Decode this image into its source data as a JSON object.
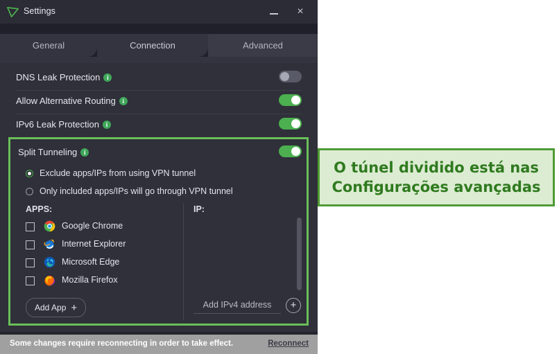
{
  "window": {
    "title": "Settings",
    "logo_icon": "vpn-triangle-logo",
    "minimize_label": "–",
    "close_label": "×"
  },
  "tabs": [
    {
      "id": "general",
      "label": "General",
      "active": false
    },
    {
      "id": "connection",
      "label": "Connection",
      "active": true
    },
    {
      "id": "advanced",
      "label": "Advanced",
      "active": false
    }
  ],
  "settings": [
    {
      "id": "dns-leak-protection",
      "label": "DNS Leak Protection",
      "info": "i",
      "toggle": "off"
    },
    {
      "id": "allow-alternative-routing",
      "label": "Allow Alternative Routing",
      "info": "i",
      "toggle": "on"
    },
    {
      "id": "ipv6-leak-protection",
      "label": "IPv6 Leak Protection",
      "info": "i",
      "toggle": "on"
    }
  ],
  "split_tunneling": {
    "label": "Split Tunneling",
    "info": "i",
    "toggle": "on",
    "radios": [
      {
        "id": "exclude",
        "label": "Exclude apps/IPs from using VPN tunnel",
        "selected": true
      },
      {
        "id": "include-only",
        "label": "Only included apps/IPs will go through VPN tunnel",
        "selected": false
      }
    ],
    "apps_column_header": "APPS:",
    "ip_column_header": "IP:",
    "apps": [
      {
        "id": "google-chrome",
        "label": "Google Chrome",
        "icon": "chrome-icon",
        "checked": false
      },
      {
        "id": "internet-explorer",
        "label": "Internet Explorer",
        "icon": "internet-explorer-icon",
        "checked": false
      },
      {
        "id": "microsoft-edge",
        "label": "Microsoft Edge",
        "icon": "edge-icon",
        "checked": false
      },
      {
        "id": "mozilla-firefox",
        "label": "Mozilla Firefox",
        "icon": "firefox-icon",
        "checked": false
      }
    ],
    "ip_entries": [],
    "add_app_label": "Add App",
    "add_app_plus": "+",
    "add_ip_label": "Add IPv4 address",
    "add_ip_plus": "+"
  },
  "status_bar": {
    "message": "Some changes require reconnecting in order to take effect.",
    "action_label": "Reconnect"
  },
  "annotation": {
    "text": "O túnel dividido está nas Configurações avançadas",
    "border_color": "#4f9b34",
    "fill_color": "#dcecd2",
    "text_color": "#2f7a1f"
  },
  "colors": {
    "window_bg": "#2f3039",
    "titlebar_bg": "#2b2c35",
    "tabstrip_bg": "#1f2029",
    "accent_green": "#4caf50",
    "highlight_green": "#6abf5a",
    "status_bar_bg": "#a0a0a0"
  }
}
